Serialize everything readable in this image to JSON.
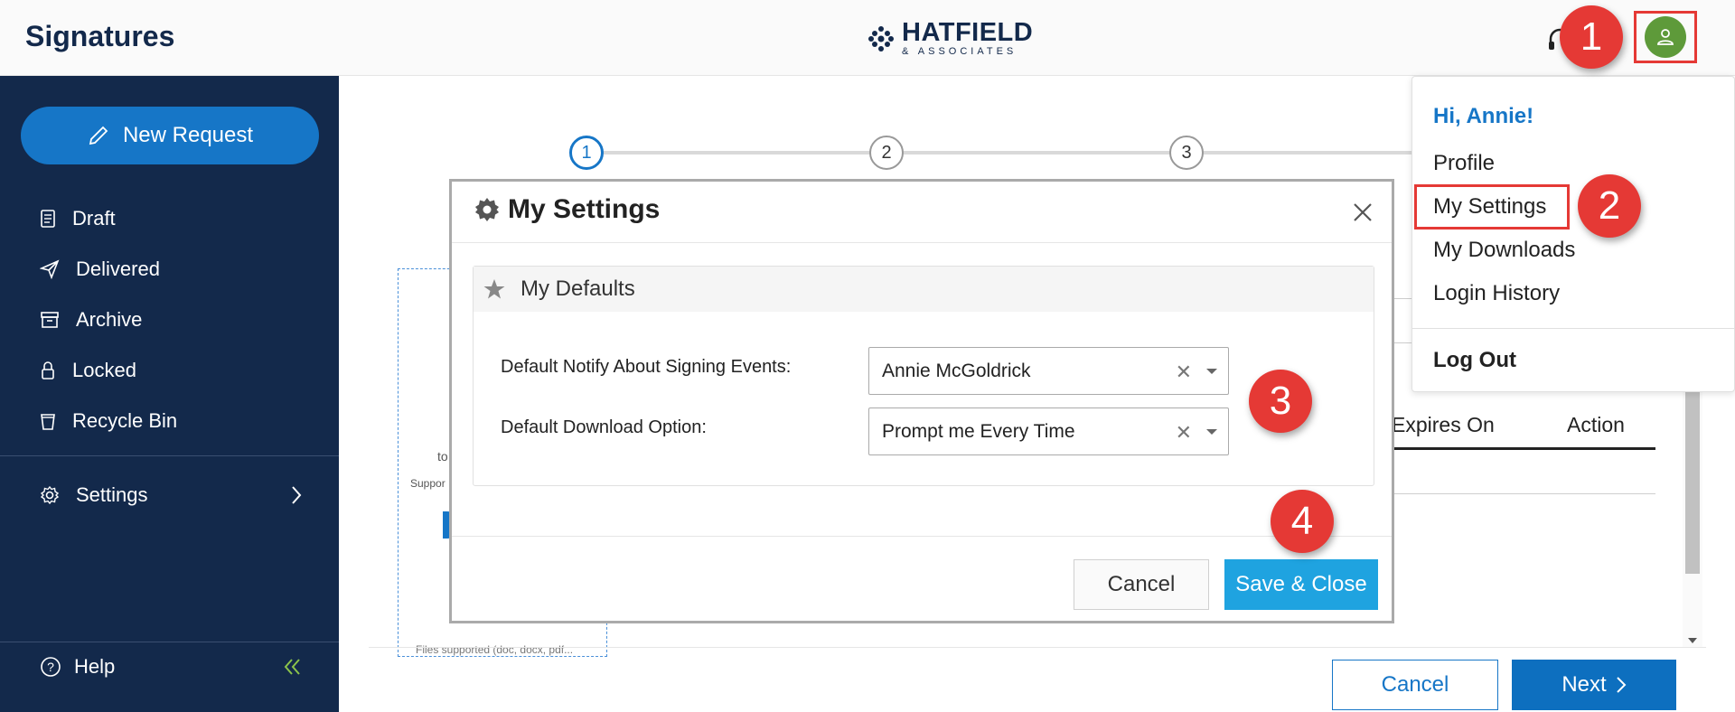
{
  "header": {
    "app_title": "Signatures",
    "logo_main": "HATFIELD",
    "logo_sub": "& ASSOCIATES"
  },
  "annotations": {
    "step1": "1",
    "step2": "2",
    "step3": "3",
    "step4": "4"
  },
  "sidebar": {
    "new_request": "New Request",
    "items": [
      {
        "label": "Draft",
        "icon": "draft-icon"
      },
      {
        "label": "Delivered",
        "icon": "paper-plane-icon"
      },
      {
        "label": "Archive",
        "icon": "archive-icon"
      },
      {
        "label": "Locked",
        "icon": "lock-icon"
      },
      {
        "label": "Recycle Bin",
        "icon": "trash-icon"
      }
    ],
    "settings": "Settings",
    "help": "Help"
  },
  "stepper": {
    "steps": [
      "1",
      "2",
      "3"
    ]
  },
  "background": {
    "drop_text": "to",
    "drop_text2": "Suppor",
    "drop_foot": "Files supported (doc, docx, pdf...",
    "table_headers": {
      "expires_on": "Expires On",
      "action": "Action"
    }
  },
  "footer_buttons": {
    "cancel": "Cancel",
    "next": "Next"
  },
  "user_menu": {
    "greeting": "Hi, Annie!",
    "items": [
      "Profile",
      "My Settings",
      "My Downloads",
      "Login History"
    ],
    "logout": "Log Out"
  },
  "modal": {
    "title": "My Settings",
    "section": "My Defaults",
    "fields": [
      {
        "label": "Default Notify About Signing Events:",
        "value": "Annie McGoldrick"
      },
      {
        "label": "Default Download Option:",
        "value": "Prompt me Every Time"
      }
    ],
    "cancel": "Cancel",
    "save": "Save & Close"
  },
  "colors": {
    "sidebar_bg": "#13294b",
    "primary": "#1676c7",
    "save_button": "#1fa3e0",
    "avatar": "#5e9a3a",
    "annotation": "#e53935"
  }
}
